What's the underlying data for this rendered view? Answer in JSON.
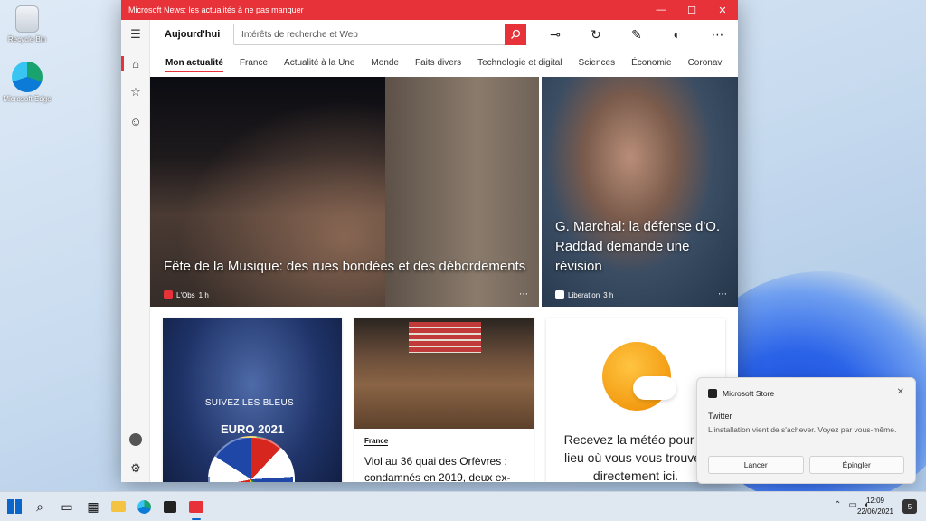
{
  "desktop": {
    "icons": [
      {
        "label": "Recycle Bin"
      },
      {
        "label": "Microsoft Edge"
      }
    ]
  },
  "window": {
    "title": "Microsoft News: les actualités à ne pas manquer",
    "minimize_glyph": "—",
    "maximize_glyph": "☐",
    "close_glyph": "✕"
  },
  "header": {
    "brand": "Aujourd'hui",
    "search_placeholder": "Intérêts de recherche et Web"
  },
  "tabs": [
    "Mon actualité",
    "France",
    "Actualité à la Une",
    "Monde",
    "Faits divers",
    "Technologie et digital",
    "Sciences",
    "Économie",
    "Coronav"
  ],
  "hero": [
    {
      "headline": "Fête de la Musique: des rues bondées et des débordements",
      "source": "L'Obs",
      "age": "1 h"
    },
    {
      "headline": "G. Marchal: la défense d'O. Raddad demande une révision",
      "source": "Liberation",
      "age": "3 h"
    }
  ],
  "cards": {
    "promo": {
      "kicker": "SUIVEZ LES BLEUS !",
      "title": "EURO 2021"
    },
    "article": {
      "kicker": "France",
      "headline": "Viol au 36 quai des Orfèvres : condamnés en 2019, deux ex-"
    },
    "weather": {
      "text": "Recevez la météo pour le lieu où vous vous trouvez directement ici."
    }
  },
  "toast": {
    "app": "Microsoft Store",
    "title": "Twitter",
    "body": "L'installation vient de s'achever. Voyez par vous-même.",
    "actions": [
      "Lancer",
      "Épingler"
    ]
  },
  "taskbar": {
    "time": "12:09",
    "date": "22/06/2021",
    "notification_count": "5"
  },
  "colors": {
    "accent": "#e63238",
    "taskbar": "#dfe7f1"
  }
}
